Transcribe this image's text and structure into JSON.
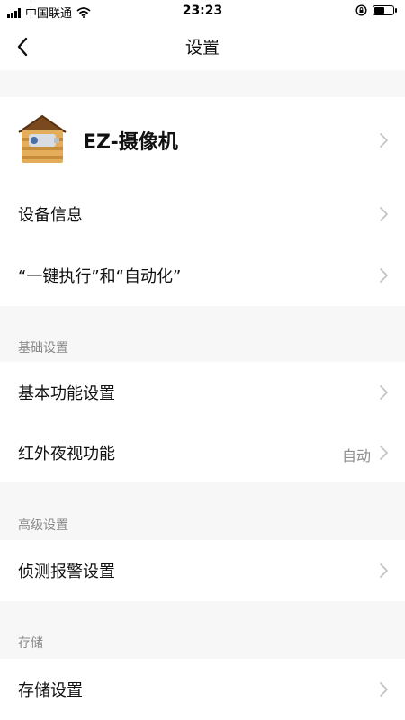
{
  "status_bar": {
    "carrier": "中国联通",
    "time": "23:23",
    "battery_level": 0.6,
    "icons": [
      "signal-icon",
      "wifi-icon",
      "orientation-lock-icon",
      "battery-icon"
    ]
  },
  "nav": {
    "title": "设置",
    "back_icon": "chevron-left-icon"
  },
  "device": {
    "name": "EZ-摄像机",
    "avatar_icon": "camera-house-icon"
  },
  "device_rows": [
    {
      "label": "设备信息"
    },
    {
      "label": "“一键执行”和“自动化”"
    }
  ],
  "sections": [
    {
      "title": "基础设置",
      "rows": [
        {
          "label": "基本功能设置",
          "value": ""
        },
        {
          "label": "红外夜视功能",
          "value": "自动"
        }
      ]
    },
    {
      "title": "高级设置",
      "rows": [
        {
          "label": "侦测报警设置",
          "value": ""
        }
      ]
    },
    {
      "title": "存储",
      "rows": [
        {
          "label": "存储设置",
          "value": ""
        }
      ]
    }
  ],
  "colors": {
    "background": "#f7f7f7",
    "card": "#ffffff",
    "secondary_text": "#8a8a8a",
    "chevron": "#c4c4c4"
  }
}
